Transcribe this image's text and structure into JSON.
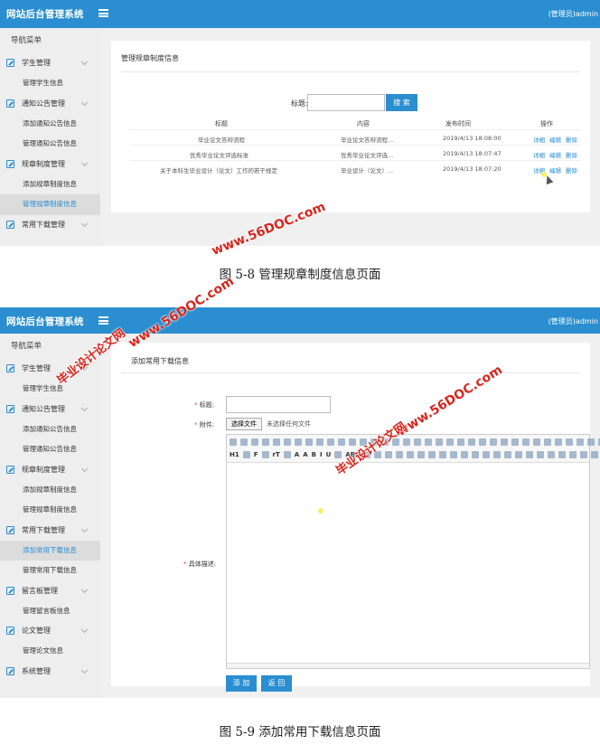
{
  "screenshot1": {
    "header": {
      "brand": "网站后台管理系统",
      "user": "(管理员)admin"
    },
    "sidebar": {
      "head": "导航菜单",
      "items": [
        {
          "kind": "group",
          "label": "学生管理"
        },
        {
          "kind": "sub",
          "label": "管理学生信息"
        },
        {
          "kind": "group",
          "label": "通知公告管理"
        },
        {
          "kind": "sub",
          "label": "添加通知公告信息"
        },
        {
          "kind": "sub",
          "label": "管理通知公告信息"
        },
        {
          "kind": "group",
          "label": "规章制度管理"
        },
        {
          "kind": "sub",
          "label": "添加规章制度信息"
        },
        {
          "kind": "sub",
          "label": "管理规章制度信息",
          "active": true
        },
        {
          "kind": "group",
          "label": "常用下载管理"
        }
      ]
    },
    "panel": {
      "title": "管理规章制度信息",
      "search_label": "标题:",
      "search_value": "",
      "search_button": "搜 索",
      "columns": [
        "标题",
        "内容",
        "发布时间",
        "操作"
      ],
      "rows": [
        {
          "title": "毕业论文答辩流程",
          "content": "毕业论文答辩流程...",
          "time": "2019/4/13 18:08:00"
        },
        {
          "title": "优秀毕业论文评选标准",
          "content": "优秀毕业论文评选...",
          "time": "2019/4/13 18:07:47"
        },
        {
          "title": "关于本科生毕业设计（论文）工作的若干规定",
          "content": "毕业设计（论文）...",
          "time": "2019/4/13 18:07:20"
        }
      ],
      "actions": [
        "详细",
        "编辑",
        "删除"
      ]
    },
    "caption": "图 5-8 管理规章制度信息页面"
  },
  "screenshot2": {
    "header": {
      "brand": "网站后台管理系统",
      "user": "(管理员)admin"
    },
    "sidebar": {
      "head": "导航菜单",
      "items": [
        {
          "kind": "group",
          "label": "学生管理"
        },
        {
          "kind": "sub",
          "label": "管理学生信息"
        },
        {
          "kind": "group",
          "label": "通知公告管理"
        },
        {
          "kind": "sub",
          "label": "添加通知公告信息"
        },
        {
          "kind": "sub",
          "label": "管理通知公告信息"
        },
        {
          "kind": "group",
          "label": "规章制度管理"
        },
        {
          "kind": "sub",
          "label": "添加规章制度信息"
        },
        {
          "kind": "sub",
          "label": "管理规章制度信息"
        },
        {
          "kind": "group",
          "label": "常用下载管理"
        },
        {
          "kind": "sub",
          "label": "添加常用下载信息",
          "active": true
        },
        {
          "kind": "sub",
          "label": "管理常用下载信息"
        },
        {
          "kind": "group",
          "label": "留言板管理"
        },
        {
          "kind": "sub",
          "label": "管理留言板信息"
        },
        {
          "kind": "group",
          "label": "论文管理"
        },
        {
          "kind": "sub",
          "label": "管理论文信息"
        },
        {
          "kind": "group",
          "label": "系统管理"
        }
      ]
    },
    "form": {
      "title": "添加常用下载信息",
      "title_label": "标题:",
      "file_label": "附件:",
      "file_button": "选择文件",
      "file_none": "未选择任何文件",
      "desc_label": "具体描述:",
      "add_button": "添 加",
      "back_button": "返 回",
      "toolbar_text": [
        "H1",
        "F",
        "rT",
        "A",
        "A",
        "B",
        "I",
        "U",
        "ABC"
      ]
    },
    "caption": "图 5-9 添加常用下载信息页面"
  },
  "watermarks": [
    "www.56DOC.com",
    "毕业设计论文网"
  ],
  "colors": {
    "header": "#2a8ed0",
    "accent": "#2a8ed0",
    "watermark": "#d7261e"
  }
}
